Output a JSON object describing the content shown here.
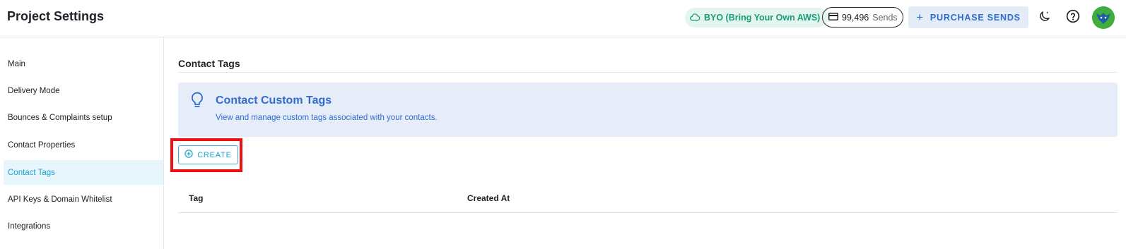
{
  "header": {
    "title": "Project Settings",
    "byo_label": "BYO (Bring Your Own AWS)",
    "sends_count": "99,496",
    "sends_unit": "Sends",
    "purchase_label": "PURCHASE SENDS"
  },
  "sidebar": {
    "items": [
      {
        "label": "Main"
      },
      {
        "label": "Delivery Mode"
      },
      {
        "label": "Bounces & Complaints setup"
      },
      {
        "label": "Contact Properties"
      },
      {
        "label": "Contact Tags"
      },
      {
        "label": "API Keys & Domain Whitelist"
      },
      {
        "label": "Integrations"
      }
    ],
    "active_item": "Contact Tags"
  },
  "main": {
    "section_title": "Contact Tags",
    "banner": {
      "title": "Contact Custom Tags",
      "text": "View and manage custom tags associated with your contacts."
    },
    "create_label": "CREATE",
    "table": {
      "columns": [
        "Tag",
        "Created At"
      ],
      "rows": []
    }
  },
  "icons": {
    "byo": "cloud-icon",
    "sends": "credit-card-icon",
    "purchase": "plus-icon",
    "theme": "moon-icon",
    "help": "help-circle-icon",
    "banner": "lightbulb-icon",
    "create": "add-circle-icon"
  },
  "colors": {
    "accent_blue": "#2f6ccf",
    "active_cyan": "#1aa3cf",
    "byo_green": "#1a9d79",
    "highlight_red": "#ee1111",
    "banner_bg": "#e6edf9"
  }
}
